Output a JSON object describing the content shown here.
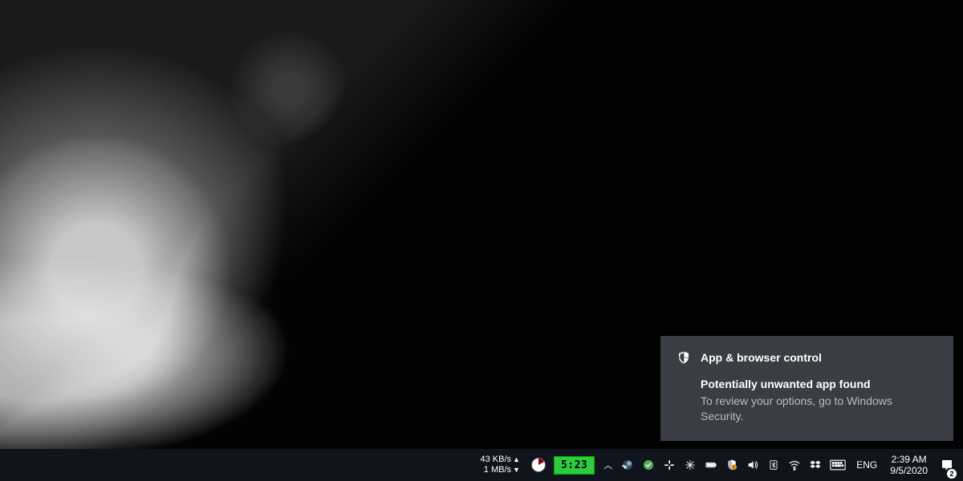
{
  "notification": {
    "app_title": "App & browser control",
    "heading": "Potentially unwanted app found",
    "message": "To review your options, go to Windows Security."
  },
  "taskbar": {
    "net_speed_down": "43 KB/s",
    "net_speed_up": "1 MB/s",
    "timer": "5:23",
    "language": "ENG",
    "time": "2:39 AM",
    "date": "9/5/2020",
    "notification_count": "2"
  }
}
